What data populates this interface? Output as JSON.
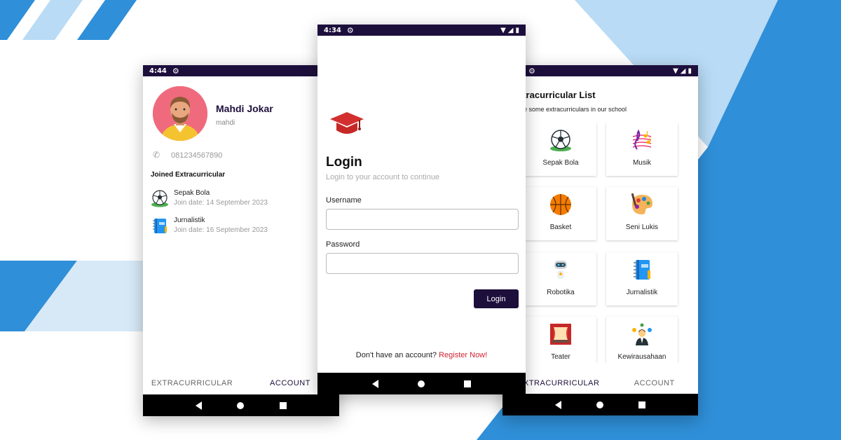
{
  "account_screen": {
    "status_time": "4:44",
    "profile": {
      "name": "Mahdi Jokar",
      "username": "mahdi",
      "phone": "081234567890"
    },
    "joined_heading": "Joined Extracurricular",
    "joined": [
      {
        "name": "Sepak Bola",
        "date": "Join date: 14 September 2023",
        "icon": "soccer-ball-icon"
      },
      {
        "name": "Jurnalistik",
        "date": "Join date: 16 September 2023",
        "icon": "notebook-icon"
      }
    ],
    "tabs": [
      "EXTRACURRICULAR",
      "ACCOUNT"
    ],
    "active_tab": "ACCOUNT"
  },
  "login_screen": {
    "status_time": "4:34",
    "title": "Login",
    "subtitle": "Login to your account to continue",
    "username_label": "Username",
    "username_value": "",
    "password_label": "Password",
    "password_value": "",
    "login_button": "Login",
    "register_prompt": "Don't have an account?",
    "register_link": "Register Now!"
  },
  "list_screen": {
    "title": "xtracurricular List",
    "subtitle": "ore some extracurriculars in our school",
    "items": [
      {
        "label": "Sepak Bola",
        "icon": "soccer-ball-icon"
      },
      {
        "label": "Musik",
        "icon": "music-notes-icon"
      },
      {
        "label": "Basket",
        "icon": "basketball-icon"
      },
      {
        "label": "Seni Lukis",
        "icon": "palette-icon"
      },
      {
        "label": "Robotika",
        "icon": "robot-icon"
      },
      {
        "label": "Jurnalistik",
        "icon": "notebook-icon"
      },
      {
        "label": "Teater",
        "icon": "theater-stage-icon"
      },
      {
        "label": "Kewirausahaan",
        "icon": "entrepreneur-icon"
      }
    ],
    "tabs": [
      "XTRACURRICULAR",
      "ACCOUNT"
    ],
    "active_tab": "XTRACURRICULAR"
  },
  "colors": {
    "primary": "#1d0f3c",
    "link": "#d02232",
    "decor_blue": "#2f8fd8",
    "decor_light": "#b9dbf5"
  }
}
